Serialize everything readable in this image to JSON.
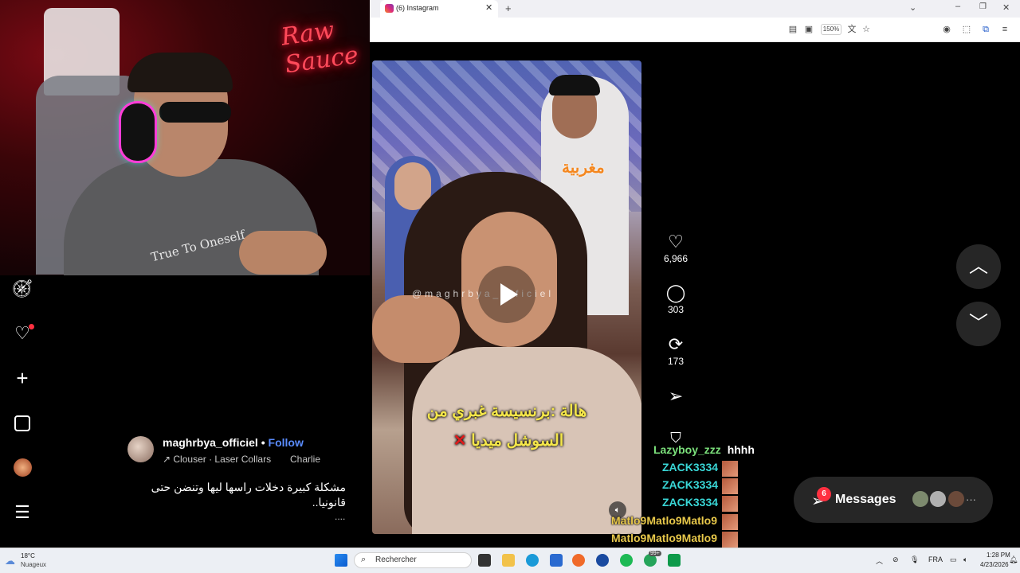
{
  "browser": {
    "tab_title": "(6) Instagram",
    "zoom": "150%"
  },
  "webcam": {
    "neon_sign": "Raw Sauce",
    "shirt_text": "True To Oneself"
  },
  "video": {
    "tag": "مغربية",
    "watermark": "@maghrbya_officiel",
    "caption_line1": "هالة :برنسيسة غبري من",
    "caption_line2": "السوشل ميديا",
    "caption_mark": "✕"
  },
  "actions": {
    "likes": "6,966",
    "comments": "303",
    "reposts": "173"
  },
  "post": {
    "username": "maghrbya_officiel",
    "separator": "•",
    "follow": "Follow",
    "audio": "↗ Clouser · Laser Collars",
    "audio2": "Charlie",
    "caption": "مشكلة كبيرة دخلات راسها ليها وتنضن حتى قانونيا..",
    "more": "...."
  },
  "messages": {
    "label": "Messages",
    "badge": "6",
    "more": "···"
  },
  "chat": [
    {
      "user": "Lazyboy_zzz",
      "text": "hhhh",
      "color": "#7be07b"
    },
    {
      "user": "ZACK3334",
      "text": "",
      "color": "#39d6d6"
    },
    {
      "user": "ZACK3334",
      "text": "",
      "color": "#39d6d6"
    },
    {
      "user": "ZACK3334",
      "text": "",
      "color": "#39d6d6"
    },
    {
      "user": "Matlo9Matlo9Matlo9",
      "text": "",
      "color": "#e8c84a"
    },
    {
      "user": "Matlo9Matlo9Matlo9",
      "text": "",
      "color": "#e8c84a"
    }
  ],
  "taskbar": {
    "weather_temp": "18°C",
    "weather_desc": "Nuageux",
    "search_placeholder": "Rechercher",
    "lang": "FRA",
    "time": "1:28 PM",
    "date": "4/23/2026",
    "notif_badge": "99+"
  }
}
